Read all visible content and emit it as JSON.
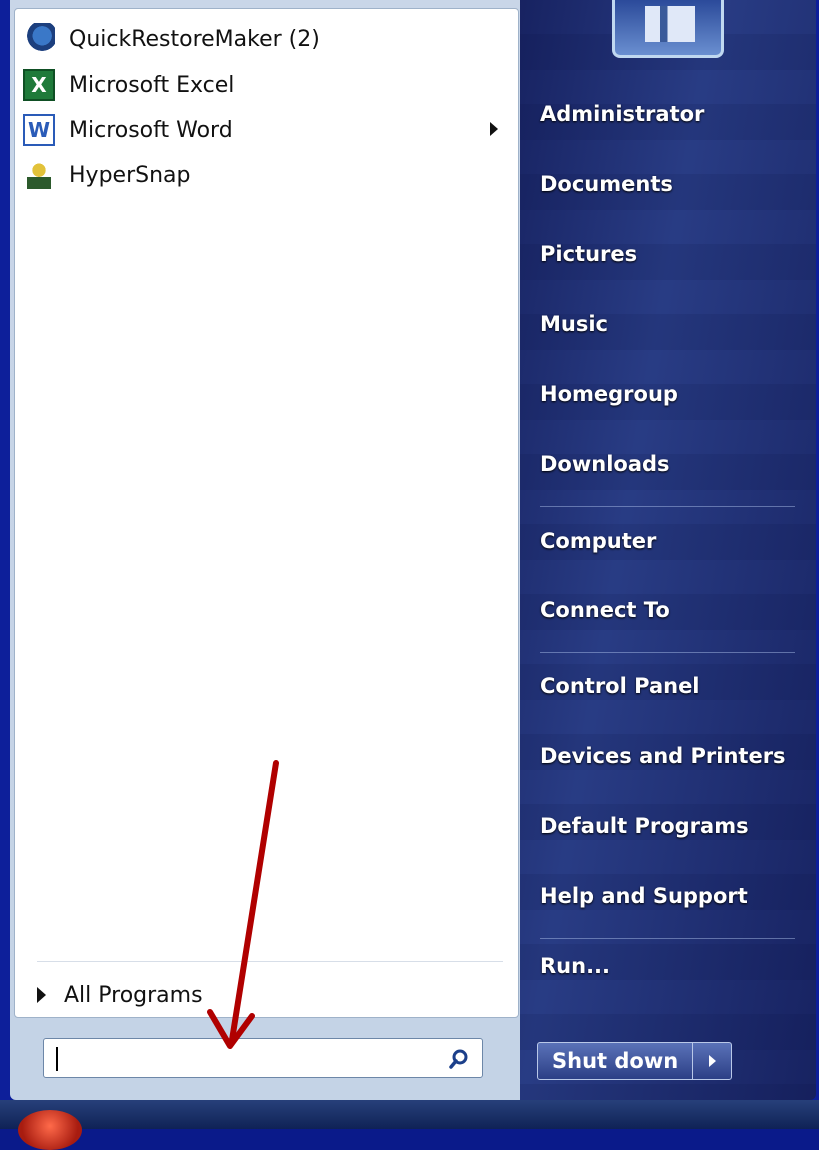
{
  "programs": [
    {
      "label": "QuickRestoreMaker (2)",
      "icon": "quickrestore-icon"
    },
    {
      "label": "Microsoft Excel",
      "icon": "excel-icon"
    },
    {
      "label": "Microsoft Word",
      "icon": "word-icon"
    },
    {
      "label": "HyperSnap",
      "icon": "hypersnap-icon"
    }
  ],
  "all_programs_label": "All Programs",
  "search": {
    "value": "",
    "placeholder": ""
  },
  "right_items": [
    "Administrator",
    "Documents",
    "Pictures",
    "Music",
    "Homegroup",
    "Downloads",
    "Computer",
    "Connect To",
    "Control Panel",
    "Devices and Printers",
    "Default Programs",
    "Help and Support",
    "Run..."
  ],
  "shutdown_label": "Shut down",
  "colors": {
    "annotation_arrow": "#b00000",
    "right_panel_text": "#ffffff"
  }
}
